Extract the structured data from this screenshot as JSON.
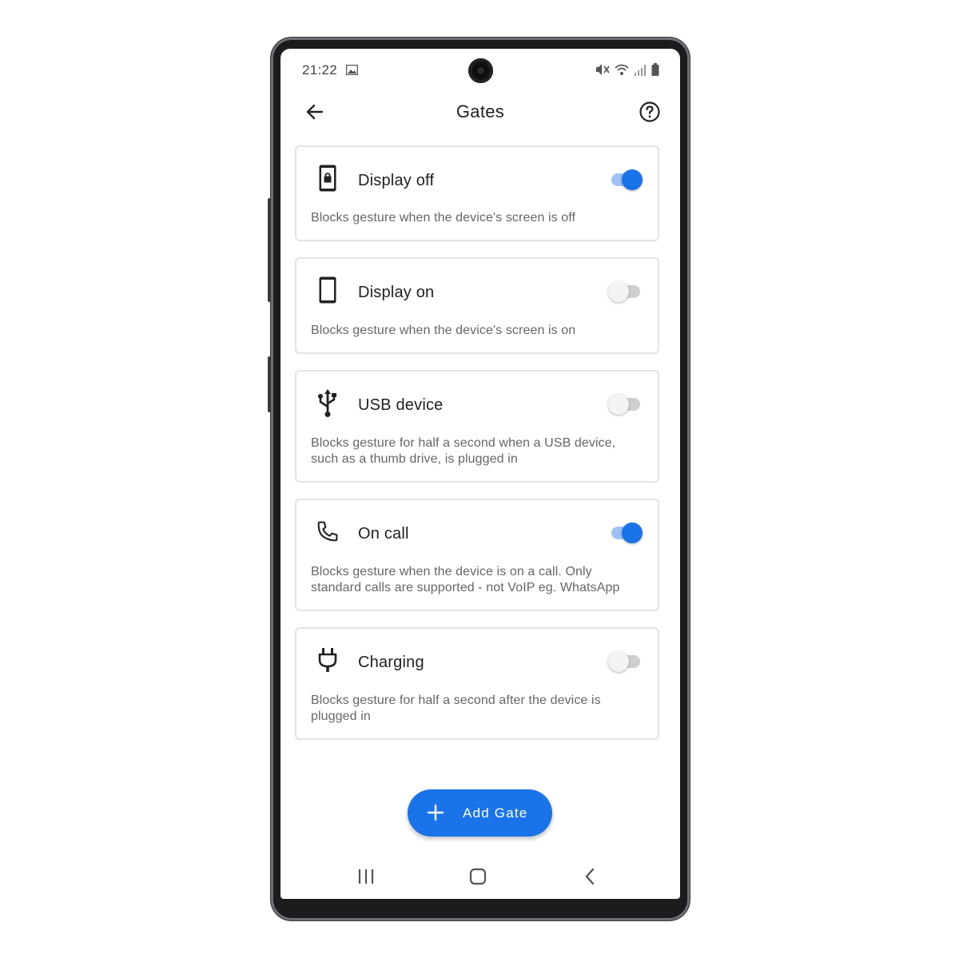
{
  "status_bar": {
    "time": "21:22",
    "icons": [
      "image-notification-icon",
      "mute-icon",
      "wifi-icon",
      "signal-icon",
      "battery-icon"
    ]
  },
  "app_bar": {
    "title": "Gates",
    "back_icon": "arrow-back-icon",
    "help_icon": "help-circle-icon"
  },
  "gates": [
    {
      "icon": "lock-phone-icon",
      "title": "Display off",
      "description": "Blocks gesture when the device's screen is off",
      "enabled": true
    },
    {
      "icon": "phone-icon",
      "title": "Display on",
      "description": "Blocks gesture when the device's screen is on",
      "enabled": false
    },
    {
      "icon": "usb-icon",
      "title": "USB device",
      "description": "Blocks gesture for half a second when a USB device, such as a thumb drive, is plugged in",
      "enabled": false
    },
    {
      "icon": "call-icon",
      "title": "On call",
      "description": "Blocks gesture when the device is on a call. Only standard calls are supported - not VoIP eg. WhatsApp",
      "enabled": true
    },
    {
      "icon": "power-plug-icon",
      "title": "Charging",
      "description": "Blocks gesture for half a second after the device is plugged in",
      "enabled": false
    }
  ],
  "fab": {
    "label": "Add Gate",
    "icon": "plus-icon"
  },
  "colors": {
    "accent": "#1a73e8",
    "track_on": "#9fc2f6",
    "track_off": "#cfcfcf"
  }
}
